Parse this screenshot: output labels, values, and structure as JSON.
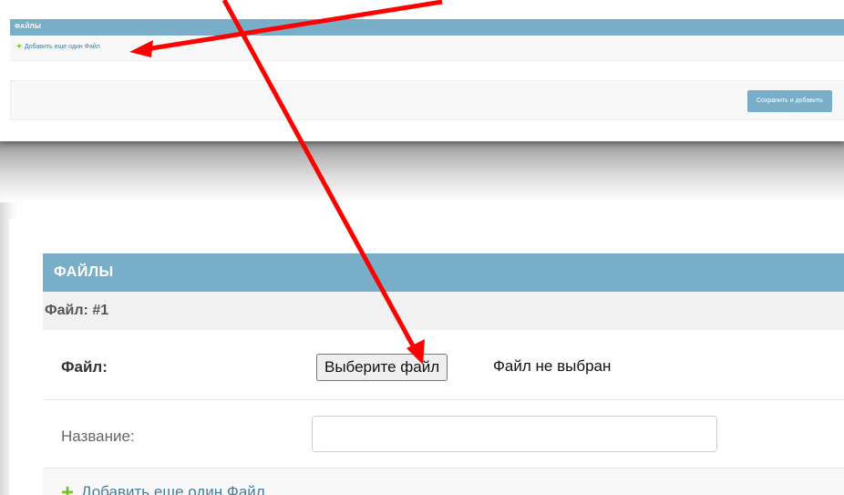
{
  "top_panel": {
    "module_title": "ФАЙЛЫ",
    "add_link": "Добавить еще один Файл",
    "save_button": "Сохранить и добавить"
  },
  "bottom_panel": {
    "module_title": "ФАЙЛЫ",
    "inline_title": "Файл: #1",
    "file_label": "Файл:",
    "file_button": "Выберите файл",
    "file_status": "Файл не выбран",
    "name_label": "Название:",
    "name_value": "",
    "add_link": "Добавить еще один Файл"
  },
  "icons": [
    "plus-icon",
    "arrow-icon"
  ],
  "colors": {
    "header": "#79aec8",
    "link": "#447e9b",
    "plus": "#70bf2b",
    "arrow": "#ff0000"
  }
}
